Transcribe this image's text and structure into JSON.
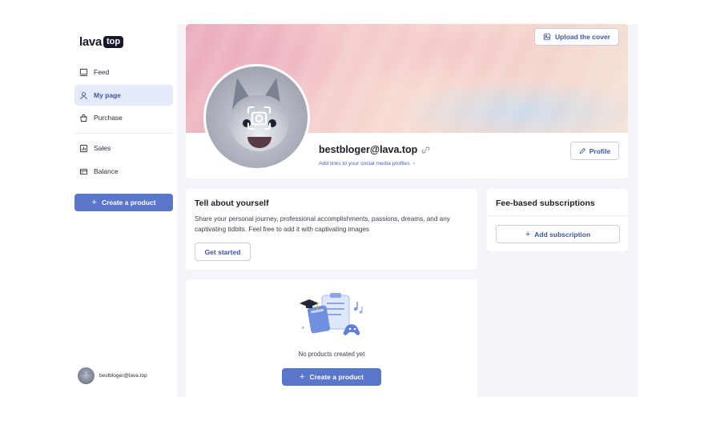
{
  "logo": {
    "word": "lava",
    "tag": "top"
  },
  "sidebar": {
    "items": [
      {
        "label": "Feed",
        "icon": "feed-icon",
        "active": false
      },
      {
        "label": "My page",
        "icon": "user-icon",
        "active": true
      },
      {
        "label": "Purchase",
        "icon": "bag-icon",
        "active": false
      },
      {
        "label": "Sales",
        "icon": "chart-icon",
        "active": false
      },
      {
        "label": "Balance",
        "icon": "wallet-icon",
        "active": false
      }
    ],
    "create_label": "Create a product",
    "user_email": "bestbloger@lava.top"
  },
  "profile": {
    "upload_cover_label": "Upload the cover",
    "username": "bestbloger@lava.top",
    "social_link": "Add links to your social media profiles",
    "profile_button": "Profile"
  },
  "about": {
    "title": "Tell about yourself",
    "text": "Share your personal journey, professional accomplishments, passions, dreams, and any captivating tidbits. Feel free to add it with captivating images",
    "button": "Get started"
  },
  "subscriptions": {
    "title": "Fee-based subscriptions",
    "button": "Add subscription"
  },
  "products": {
    "empty_text": "No products created yet",
    "button": "Create a product"
  },
  "colors": {
    "accent": "#5a76cb",
    "link": "#3c54b0",
    "background": "#f3f5fb"
  }
}
